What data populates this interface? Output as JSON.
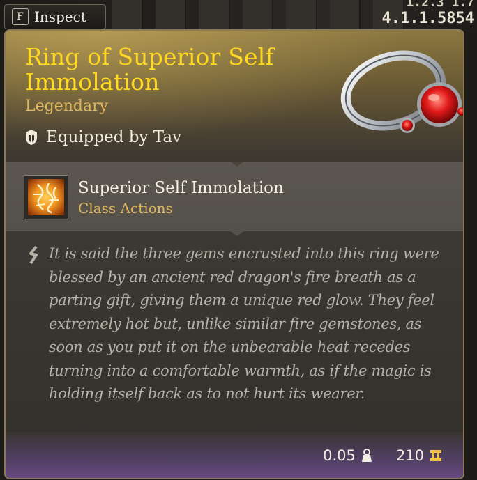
{
  "hud": {
    "version_top": "1.2.3_1.7",
    "version": "4.1.1.5854",
    "inspect_key": "F",
    "inspect_label": "Inspect"
  },
  "item": {
    "name": "Ring of Superior Self Immolation",
    "rarity": "Legendary",
    "equipped_text": "Equipped by Tav",
    "rarity_color": "#e0b75a",
    "name_color": "#ffd81f"
  },
  "action": {
    "name": "Superior Self Immolation",
    "type": "Class Actions"
  },
  "description": "It is said the three gems encrusted into this ring were blessed by an ancient red dragon's fire breath as a parting gift, giving them a unique red glow. They feel extremely hot but, unlike similar fire gemstones, as soon as you put it on the unbearable heat recedes turning into a comfortable warmth, as if the magic is holding itself back as to not hurt its wearer.",
  "footer": {
    "weight": "0.05",
    "value": "210",
    "weight_icon": "weight-icon",
    "gold_icon": "gold-icon"
  }
}
